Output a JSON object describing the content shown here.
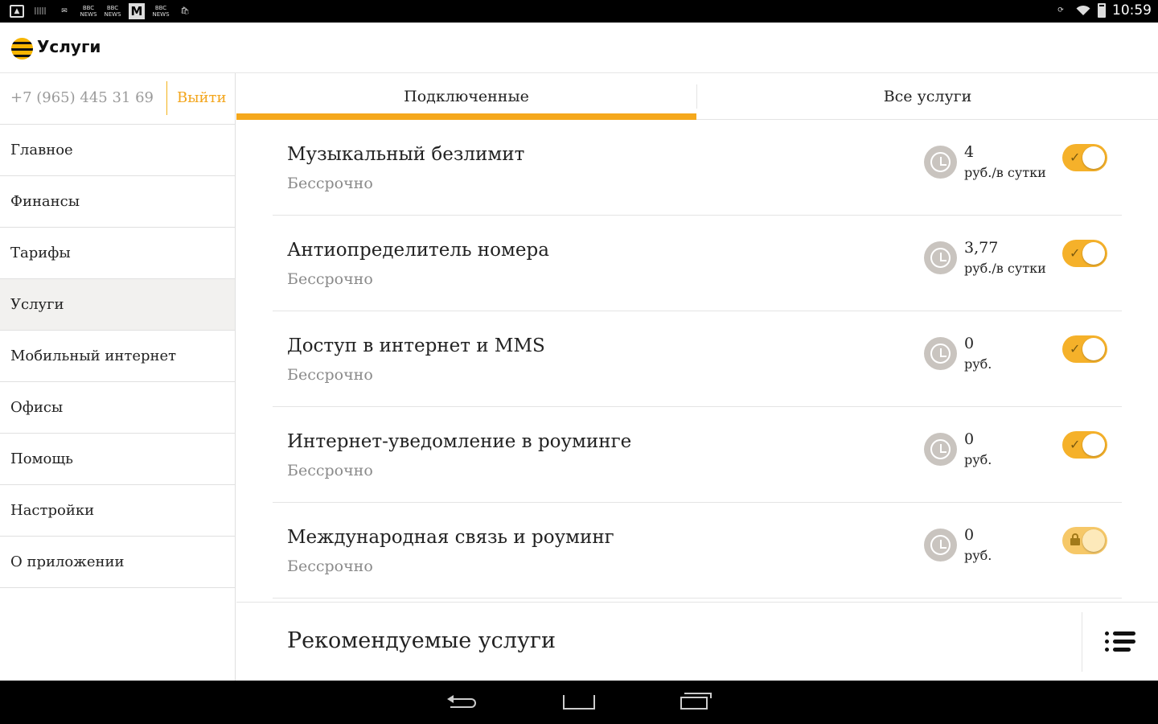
{
  "status_bar": {
    "time": "10:59",
    "notification_icons": [
      "image-icon",
      "barcode-icon",
      "gmail-icon",
      "bbc-news-icon",
      "bbc-news-icon",
      "m-app-icon",
      "bbc-news-icon",
      "store-icon"
    ],
    "news_label_top": "BBC",
    "news_label_bottom": "NEWS",
    "m_label": "M"
  },
  "app_bar": {
    "title": "Услуги"
  },
  "account": {
    "phone": "+7 (965) 445 31 69",
    "logout_label": "Выйти"
  },
  "sidebar": {
    "items": [
      {
        "label": "Главное",
        "active": false
      },
      {
        "label": "Финансы",
        "active": false
      },
      {
        "label": "Тарифы",
        "active": false
      },
      {
        "label": "Услуги",
        "active": true
      },
      {
        "label": "Мобильный интернет",
        "active": false
      },
      {
        "label": "Офисы",
        "active": false
      },
      {
        "label": "Помощь",
        "active": false
      },
      {
        "label": "Настройки",
        "active": false
      },
      {
        "label": "О приложении",
        "active": false
      }
    ]
  },
  "tabs": {
    "connected": "Подключенные",
    "all": "Все услуги",
    "selected": "connected"
  },
  "services": [
    {
      "name": "Музыкальный безлимит",
      "term": "Бессрочно",
      "price": "4",
      "unit": "руб./в сутки",
      "enabled": true,
      "locked": false
    },
    {
      "name": "Антиопределитель номера",
      "term": "Бессрочно",
      "price": "3,77",
      "unit": "руб./в сутки",
      "enabled": true,
      "locked": false
    },
    {
      "name": "Доступ в интернет и MMS",
      "term": "Бессрочно",
      "price": "0",
      "unit": "руб.",
      "enabled": true,
      "locked": false
    },
    {
      "name": "Интернет-уведомление в роуминге",
      "term": "Бессрочно",
      "price": "0",
      "unit": "руб.",
      "enabled": true,
      "locked": false
    },
    {
      "name": "Международная связь и роуминг",
      "term": "Бессрочно",
      "price": "0",
      "unit": "руб.",
      "enabled": true,
      "locked": true
    }
  ],
  "recommended": {
    "title": "Рекомендуемые услуги"
  },
  "colors": {
    "accent": "#f5a81c",
    "toggle_on": "#f5b12a",
    "toggle_locked": "#f6c868",
    "logout_text": "#f3a51b",
    "active_nav_bg": "#f2f1ef"
  }
}
